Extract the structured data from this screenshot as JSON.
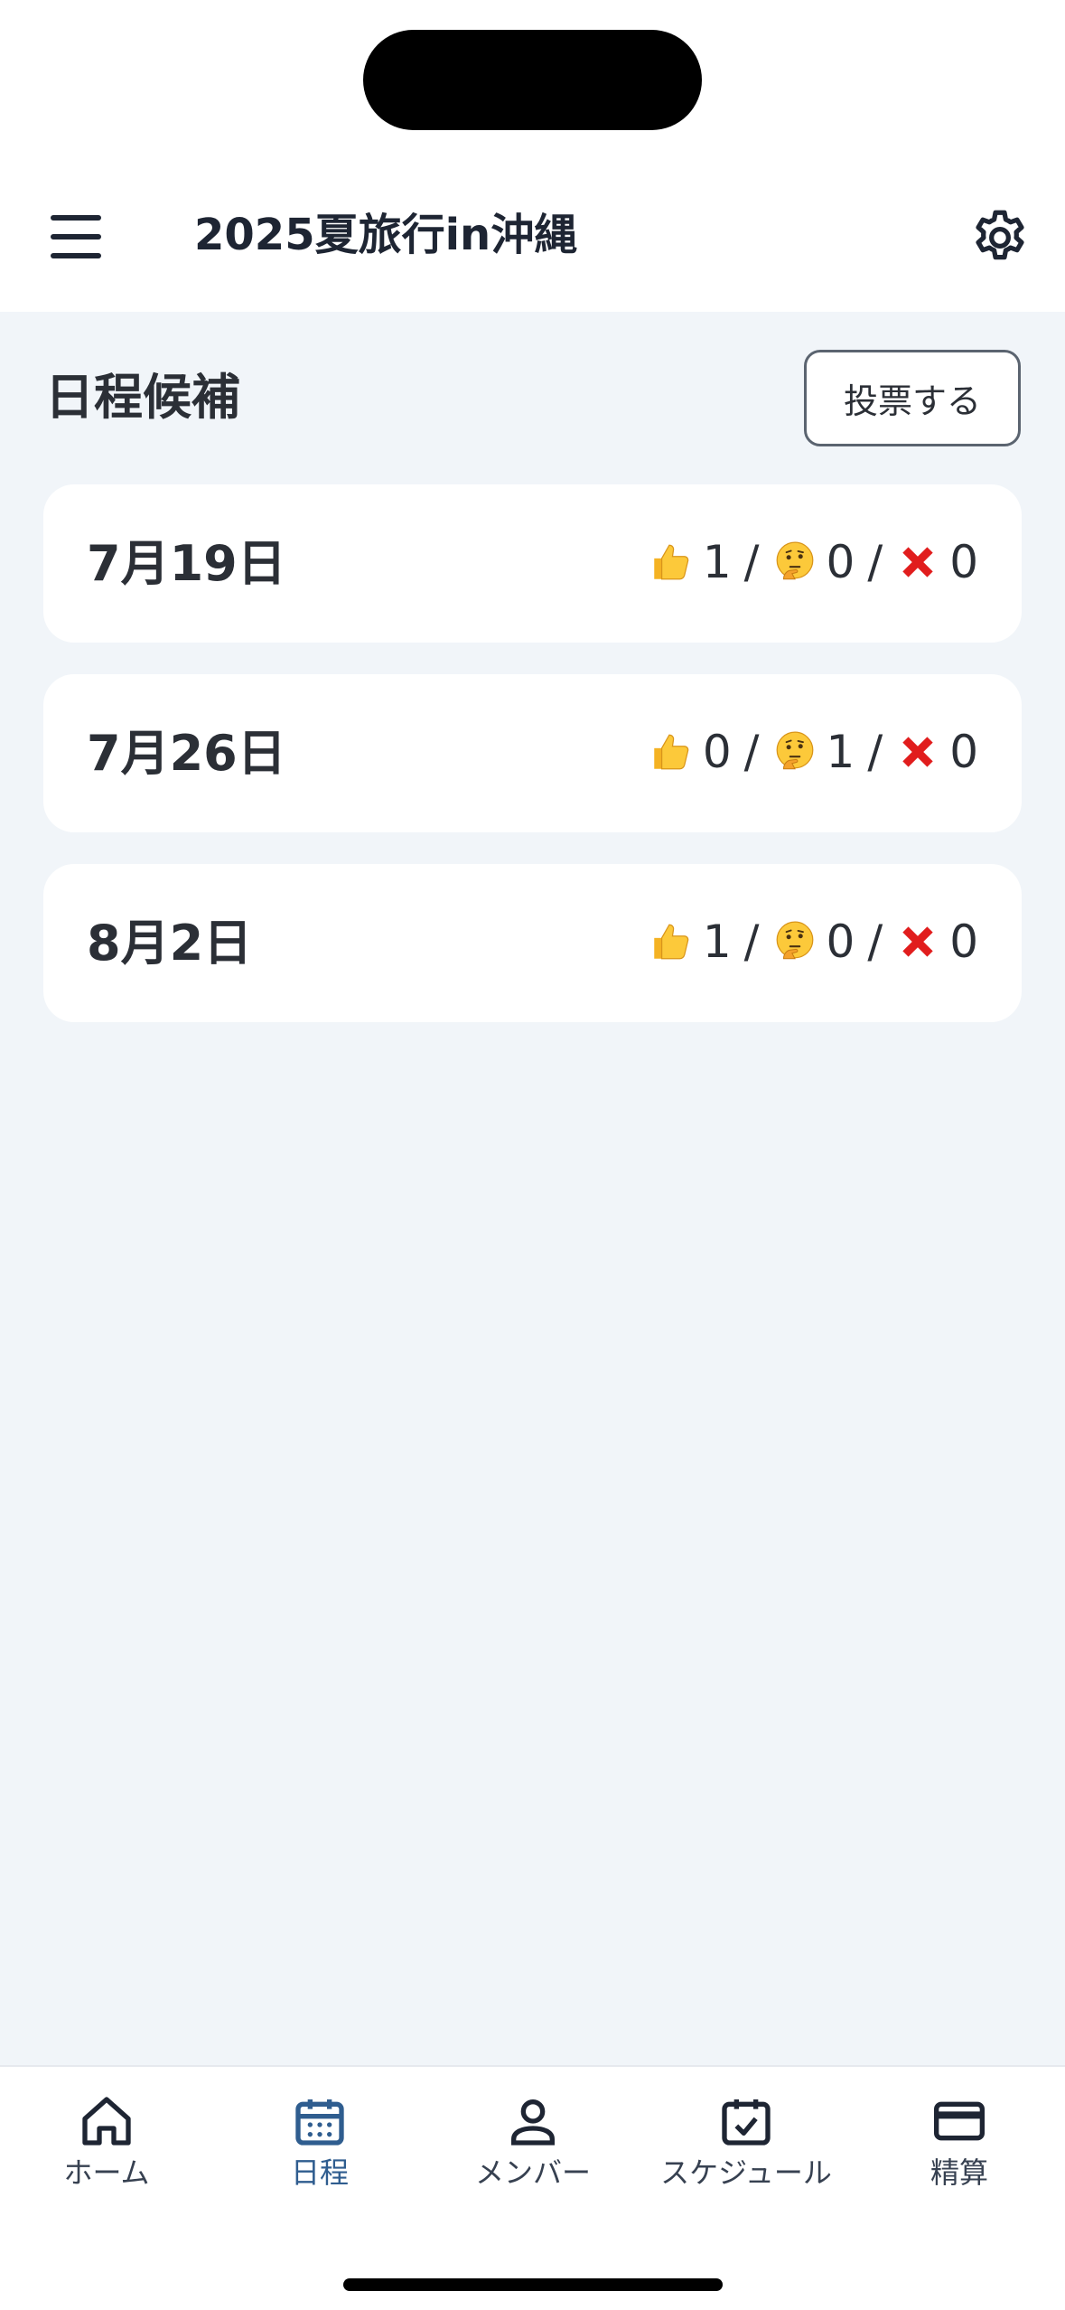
{
  "header": {
    "title": "2025夏旅行in沖縄"
  },
  "section": {
    "title": "日程候補",
    "vote_button": "投票する"
  },
  "candidates": [
    {
      "date": "7月19日",
      "good": "1",
      "maybe": "0",
      "no": "0"
    },
    {
      "date": "7月26日",
      "good": "0",
      "maybe": "1",
      "no": "0"
    },
    {
      "date": "8月2日",
      "good": "1",
      "maybe": "0",
      "no": "0"
    }
  ],
  "vote_separator": "/",
  "icons": {
    "good": "thumbs-up-icon",
    "maybe": "thinking-face-icon",
    "no": "red-cross-icon"
  },
  "tabs": [
    {
      "label": "ホーム",
      "icon": "home-icon"
    },
    {
      "label": "日程",
      "icon": "calendar-icon",
      "active": true
    },
    {
      "label": "メンバー",
      "icon": "person-icon"
    },
    {
      "label": "スケジュール",
      "icon": "calendar-check-icon"
    },
    {
      "label": "精算",
      "icon": "credit-card-icon"
    }
  ],
  "colors": {
    "background": "#f1f5f9",
    "active_tab": "#2f5d8f",
    "no_vote": "#e11d1d"
  }
}
